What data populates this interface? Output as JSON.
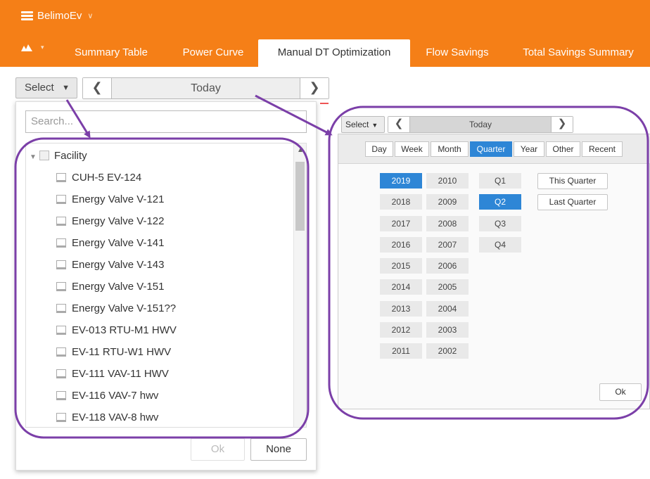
{
  "app": {
    "title": "BelimoEv"
  },
  "tabs": [
    {
      "label": "Summary Table"
    },
    {
      "label": "Power Curve"
    },
    {
      "label": "Manual DT Optimization"
    },
    {
      "label": "Flow Savings"
    },
    {
      "label": "Total Savings Summary"
    }
  ],
  "toolbar": {
    "select_label": "Select",
    "today_label": "Today"
  },
  "dropdown": {
    "search_placeholder": "Search...",
    "root_label": "Facility",
    "items": [
      "CUH-5 EV-124",
      "Energy Valve V-121",
      "Energy Valve V-122",
      "Energy Valve V-141",
      "Energy Valve V-143",
      "Energy Valve V-151",
      "Energy Valve V-151??",
      "EV-013 RTU-M1 HWV",
      "EV-11 RTU-W1 HWV",
      "EV-111 VAV-11 HWV",
      "EV-116 VAV-7 hwv",
      "EV-118 VAV-8 hwv"
    ],
    "ok_label": "Ok",
    "none_label": "None"
  },
  "calendar": {
    "select_label": "Select",
    "today_label": "Today",
    "period_tabs": [
      "Day",
      "Week",
      "Month",
      "Quarter",
      "Year",
      "Other",
      "Recent"
    ],
    "active_period": "Quarter",
    "years_col1": [
      "2019",
      "2018",
      "2017",
      "2016",
      "2015",
      "2014",
      "2013",
      "2012",
      "2011"
    ],
    "years_col2": [
      "2010",
      "2009",
      "2008",
      "2007",
      "2006",
      "2005",
      "2004",
      "2003",
      "2002"
    ],
    "selected_year": "2019",
    "quarters": [
      "Q1",
      "Q2",
      "Q3",
      "Q4"
    ],
    "selected_quarter": "Q2",
    "this_quarter_label": "This Quarter",
    "last_quarter_label": "Last Quarter",
    "ok_label": "Ok"
  },
  "colors": {
    "brand": "#f57f17",
    "accent": "#2e86d6",
    "annotation": "#7b3fa8"
  }
}
